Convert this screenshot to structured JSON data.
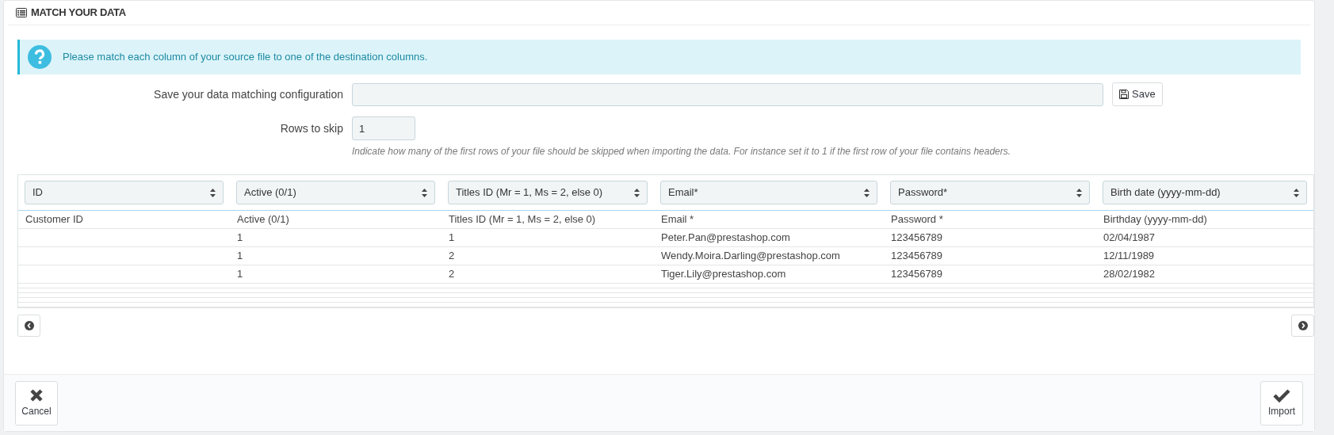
{
  "panel": {
    "title": "MATCH YOUR DATA"
  },
  "alert": {
    "text": "Please match each column of your source file to one of the destination columns."
  },
  "config": {
    "label": "Save your data matching configuration",
    "button": "Save"
  },
  "skip": {
    "label": "Rows to skip",
    "value": "1",
    "help": "Indicate how many of the first rows of your file should be skipped when importing the data. For instance set it to 1 if the first row of your file contains headers."
  },
  "columns": [
    {
      "select": "ID",
      "header": "Customer ID"
    },
    {
      "select": "Active (0/1)",
      "header": "Active (0/1)"
    },
    {
      "select": "Titles ID (Mr = 1, Ms = 2, else 0)",
      "header": "Titles ID (Mr = 1, Ms = 2, else 0)"
    },
    {
      "select": "Email*",
      "header": "Email *"
    },
    {
      "select": "Password*",
      "header": "Password *"
    },
    {
      "select": "Birth date (yyyy-mm-dd)",
      "header": "Birthday (yyyy-mm-dd)"
    }
  ],
  "rows": [
    {
      "cells": [
        null,
        "1",
        "1",
        "Peter.Pan@prestashop.com",
        "123456789",
        "02/04/1987"
      ]
    },
    {
      "cells": [
        null,
        "1",
        "2",
        "Wendy.Moira.Darling@prestashop.com",
        "123456789",
        "12/11/1989"
      ]
    },
    {
      "cells": [
        null,
        "1",
        "2",
        "Tiger.Lily@prestashop.com",
        "123456789",
        "28/02/1982"
      ]
    }
  ],
  "footer": {
    "cancel": "Cancel",
    "import": "Import"
  }
}
